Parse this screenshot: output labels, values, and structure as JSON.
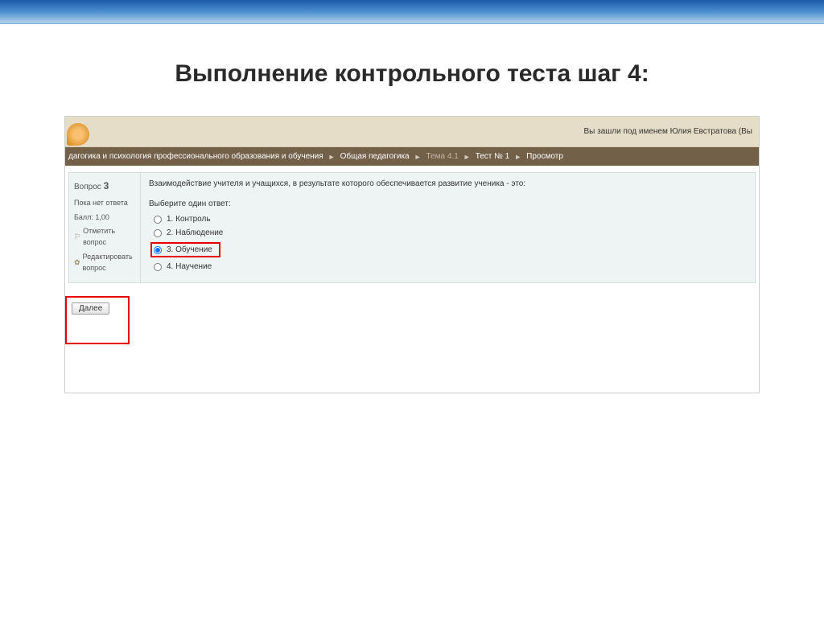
{
  "slide": {
    "title": "Выполнение контрольного теста шаг 4:"
  },
  "header": {
    "login_text": "Вы зашли под именем Юлия Евстратова (Вы"
  },
  "breadcrumb": {
    "items": [
      "дагогика и психология профессионального образования и обучения",
      "Общая педагогика",
      "Тема 4.1",
      "Тест № 1",
      "Просмотр"
    ]
  },
  "question": {
    "label_prefix": "Вопрос",
    "number": "3",
    "status": "Пока нет ответа",
    "score_label": "Балл: 1,00",
    "flag_label": "Отметить вопрос",
    "edit_label": "Редактировать вопрос",
    "text": "Взаимодействие учителя и учащихся, в результате которого обеспечивается развитие ученика - это:",
    "instruction": "Выберите один ответ:",
    "answers": [
      "1. Контроль",
      "2. Наблюдение",
      "3. Обучение",
      "4. Научение"
    ],
    "selected_index": 2
  },
  "nav": {
    "next_label": "Далее"
  }
}
